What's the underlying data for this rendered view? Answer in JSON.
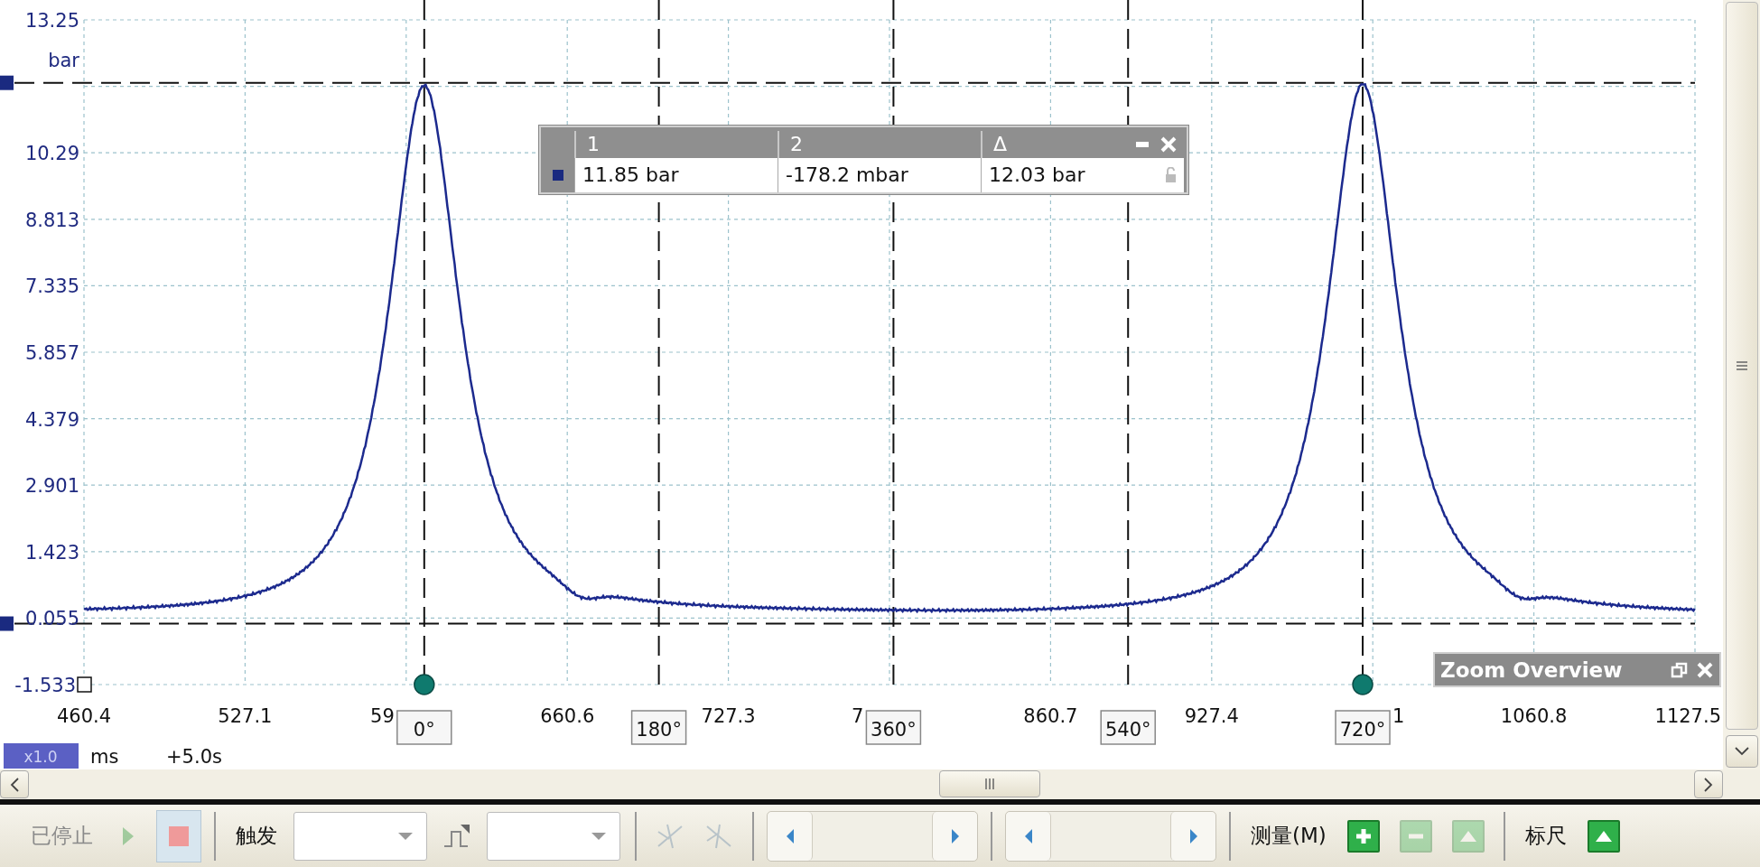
{
  "chart": {
    "unit": "bar",
    "y_ticks": [
      "13.25",
      "10.29",
      "8.813",
      "7.335",
      "5.857",
      "4.379",
      "2.901",
      "1.423",
      "0.055",
      "-1.533"
    ],
    "x_ticks": [
      "460.4",
      "527.1",
      "59",
      "660.6",
      "727.3",
      "7",
      "860.7",
      "927.4",
      "1",
      "1060.8",
      "1127.5"
    ],
    "phase_markers": [
      {
        "label": "0°",
        "handle": true
      },
      {
        "label": "180°",
        "handle": false
      },
      {
        "label": "360°",
        "handle": false
      },
      {
        "label": "540°",
        "handle": false
      },
      {
        "label": "720°",
        "handle": true
      }
    ],
    "scale_badge": "x1.0",
    "x_unit": "ms",
    "time_offset": "+5.0s"
  },
  "measurements": {
    "columns": [
      "1",
      "2",
      "Δ"
    ],
    "rows": [
      {
        "color": "#1a2a80",
        "values": [
          "11.85 bar",
          "-178.2 mbar",
          "12.03 bar"
        ]
      }
    ]
  },
  "zoom_overview": {
    "title": "Zoom Overview"
  },
  "toolbar": [
    {
      "kind": "label",
      "text": "已停止",
      "disabled": true
    },
    {
      "kind": "run",
      "disabled": true
    },
    {
      "kind": "stop",
      "pressed": true
    },
    {
      "kind": "divider"
    },
    {
      "kind": "label",
      "text": "触发",
      "disabled": false
    },
    {
      "kind": "dropdown"
    },
    {
      "kind": "trigger-type",
      "disabled": false
    },
    {
      "kind": "dropdown"
    },
    {
      "kind": "divider"
    },
    {
      "kind": "edge-rising",
      "disabled": true
    },
    {
      "kind": "edge-falling",
      "disabled": true
    },
    {
      "kind": "divider"
    },
    {
      "kind": "spinner"
    },
    {
      "kind": "divider"
    },
    {
      "kind": "spinner"
    },
    {
      "kind": "divider"
    },
    {
      "kind": "label",
      "text": "测量(M)",
      "disabled": false
    },
    {
      "kind": "add",
      "disabled": false
    },
    {
      "kind": "remove",
      "disabled": true
    },
    {
      "kind": "edit",
      "disabled": true
    },
    {
      "kind": "divider"
    },
    {
      "kind": "label",
      "text": "标尺",
      "disabled": false
    },
    {
      "kind": "add-ruler",
      "disabled": false
    }
  ]
}
